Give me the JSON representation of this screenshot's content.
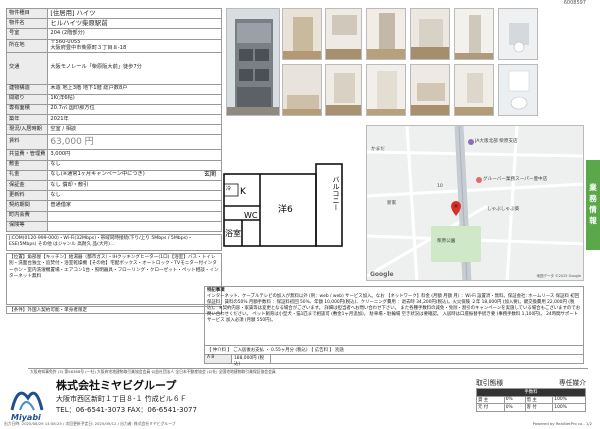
{
  "doc_id": "6008597",
  "spec_rows": [
    {
      "key": "物件種目",
      "value": "[住居用] ハイツ",
      "cls": "big"
    },
    {
      "key": "物件名",
      "value": "ヒルハイツ柴原駅前",
      "cls": "big"
    },
    {
      "key": "号室",
      "value": "204 (2階部分)",
      "cls": ""
    },
    {
      "key": "所在地",
      "value": "〒560-0055\n大阪府豊中市柴原町３丁目８-18",
      "cls": ""
    },
    {
      "key": "交通",
      "value": "大阪モノレール「柴原阪大前」徒歩7分",
      "cls": "",
      "tall": true
    },
    {
      "key": "建物構造",
      "value": "木造 地上3階 地下1階 総戸数8戸",
      "cls": ""
    },
    {
      "key": "間取り",
      "value": "1K(洋6帖)",
      "cls": ""
    },
    {
      "key": "専有面積",
      "value": "20.7㎡   国印那方位",
      "cls": ""
    },
    {
      "key": "築年",
      "value": "2021年",
      "cls": ""
    },
    {
      "key": "現況/入居時期",
      "value": "空室 / 相談",
      "cls": ""
    },
    {
      "key": "賃料",
      "value": "63,000 円",
      "cls": "price"
    },
    {
      "key": "共益費・管理費",
      "value": "3,000円",
      "cls": ""
    },
    {
      "key": "敷金",
      "value": "なし",
      "cls": ""
    },
    {
      "key": "礼金",
      "value": "なし(※通常1ヶ月キャンペーン中につき)",
      "cls": ""
    },
    {
      "key": "保証金",
      "value": "なし       償却・敷引",
      "cls": ""
    },
    {
      "key": "更新料",
      "value": "なし",
      "cls": ""
    },
    {
      "key": "契約期間",
      "value": "普通借家",
      "cls": ""
    },
    {
      "key": "町内会費",
      "value": "",
      "cls": ""
    },
    {
      "key": "保険等",
      "value": "",
      "cls": ""
    }
  ],
  "notes": {
    "internet": "J:COM(0120-999-000)・Wi-Fi(32Mbps)・帯域同時接続(下り/上り 5Mbps / 5Mbps)・ESE(5Mbps) その他 はジャンル 高耐久 品(大月)...",
    "equipment_head": "【設備】",
    "equipment": "【位置】角部屋【キッチン】給湯器（都市ガス）・IHクッキングヒーター(1口)【浴室】バス・トイレ別・洗面台独立・追焚付・浴室乾燥機【その他】宅配ボックス・オートロック・TVモニター付インターホン・室内洗濯機置場・エアコン1台・照明器具・フローリング・クローゼット・ペット相談・インターネット無料",
    "condition": "【条件】外国人契約可能・単身者限定"
  },
  "plan": {
    "rooms": [
      "玄関",
      "K",
      "浴室",
      "WC",
      "洋6",
      "バルコニー",
      "冷"
    ]
  },
  "map_labels": {
    "station": "JA大阪北部 柴原支店",
    "store": "グルーバー業務スーパー豊中店",
    "school": "柴原公園",
    "labels": [
      "かまだ",
      "10",
      "新家",
      "しゃぶしゃぶ葵",
      "Google",
      "地図データ ©2025 Google"
    ]
  },
  "side_tab": [
    "業",
    "務",
    "情",
    "報"
  ],
  "remarks": {
    "title": "特記事項",
    "text": "インターネット、ケーブルテレビの加入が無料以外 (例：web / web) サービス加入。なお 【ネットワーク】料金 (月額 月額 月) ：Wi-Fi 設置済・無料。保証会社: ホームリース 保証料 初回保証料：賃料の50% 月額手数料 ：保証料初回 50%、年額 10,000円(税込)、クリーニング費用 ：退去時 34,200円(税込)。火災保険 ２年 18,000円 (加入要)。鍵交換費用 22,000円 (税込)。 ※契約内容・家賃等は変更となる場合がございます。 詳細は担当者へお問い合わせ下さい。 また各種手数料の減免・免除・割引のキャンペーンを実施している場合もございますのでお問い合わせください。 ペット飼育は小型犬・猫1匹まで相談可 (敷金1ヶ月追加)。 駐車場・駐輪場 空き状況は要確認。 入居時は口座振替手続き要 (事務手数料 1,100円)。 24時間サポートサービス 加入必須 (月額 550円)。",
    "fee_line": "【 仲介料 】 ご入居後お支払 ・ 0.55ヶ月分 (税込)   【 広告料 】   別途",
    "fee_cell": "A B",
    "fee_value": "188,000円 (税込)"
  },
  "footer": {
    "license": "大阪府知事免許 (3) 第56368号   (一社) 大阪府宅地建物取引業協会会員   公益社団法人 全日本不動産協会   (公社) 全国宅地建物取引業保証協会会員",
    "company": "株式会社ミヤビグループ",
    "address": "大阪市西区新町１丁目８-１  竹成ビル６Ｆ",
    "tel": "TEL：06-6541-3073  FAX：06-6541-3077",
    "logo_text": "Miyabi",
    "deal_head_left": "取引態様",
    "deal_head_right": "専任媒介",
    "deal_headers": [
      "手数料",
      "",
      ""
    ],
    "deal_rows": [
      [
        "貸 主",
        "0%",
        "借 主",
        "100%"
      ],
      [
        "元 付",
        "0%",
        "客 付",
        "100%"
      ]
    ],
    "stamp_left": "出力日時: 2025/08/29 14:58:25 / 次回更新予定日: 2025/09/12 / 出力者: 株式会社ミヤビグループ",
    "stamp_right": "Powered by RealNetPro co., 1/2"
  }
}
